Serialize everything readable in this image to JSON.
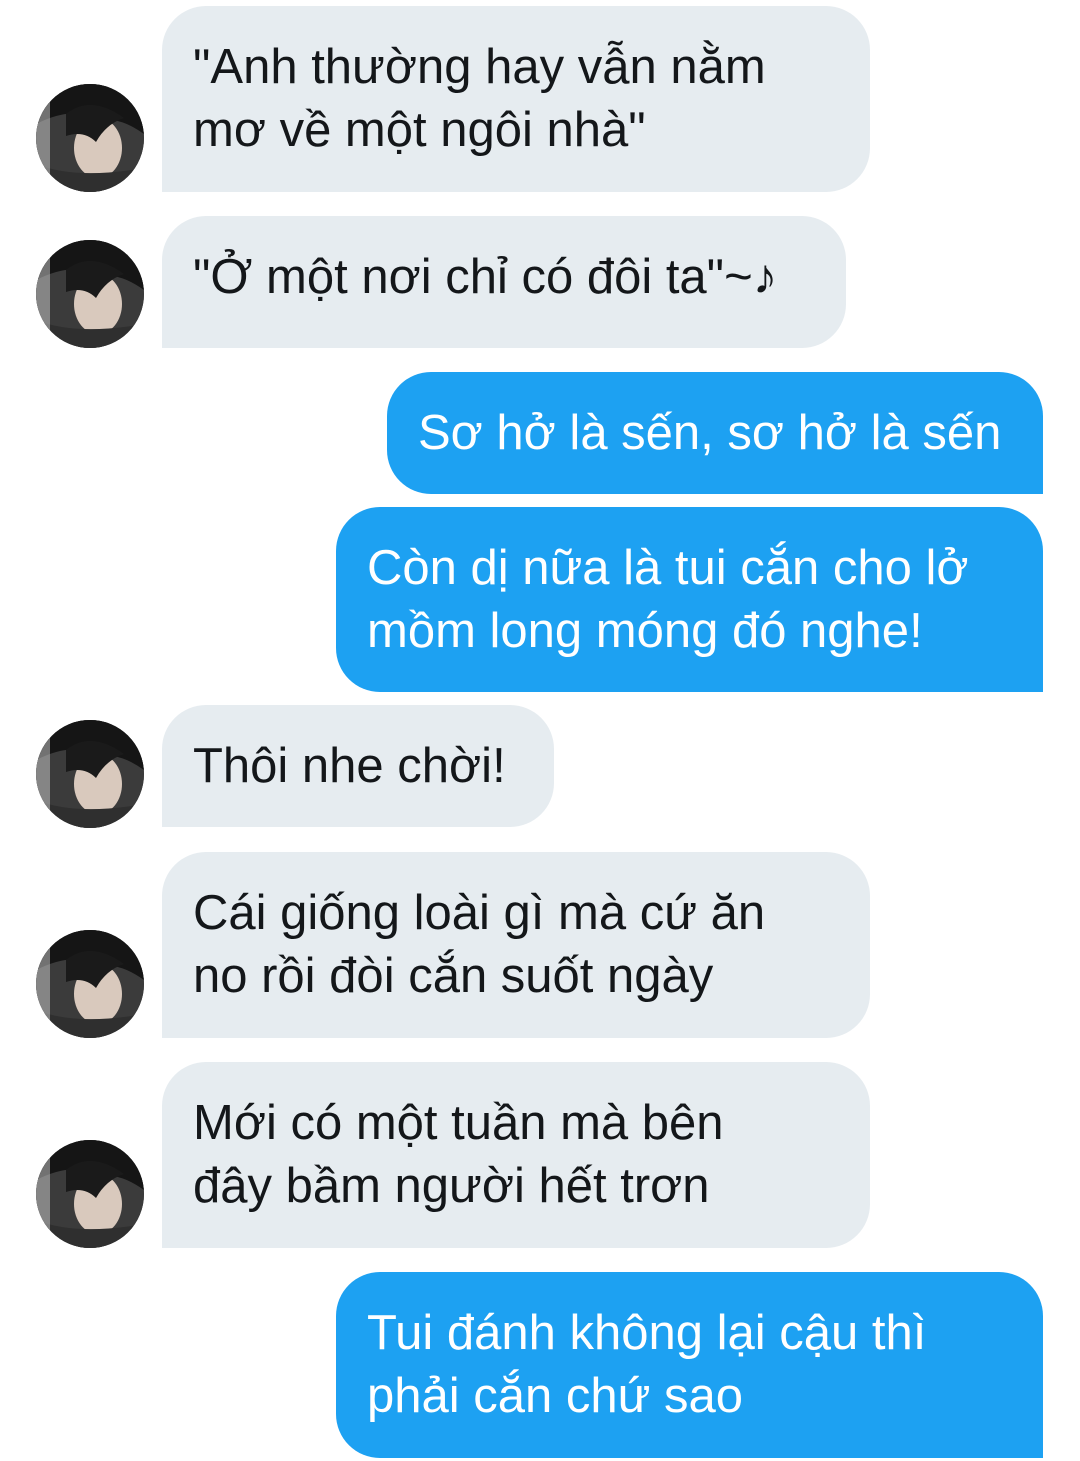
{
  "conversation": {
    "messages": [
      {
        "direction": "incoming",
        "text": "\"Anh thường hay vẫn nằm\nmơ về một ngôi nhà\"",
        "has_avatar": true
      },
      {
        "direction": "incoming",
        "text": "\"Ở một nơi chỉ có đôi ta\"~♪",
        "has_avatar": true
      },
      {
        "direction": "outgoing",
        "text": "Sơ hở là sến, sơ hở là sến"
      },
      {
        "direction": "outgoing",
        "text": "Còn dị nữa là tui cắn cho lở\nmồm long móng đó nghe!"
      },
      {
        "direction": "incoming",
        "text": "Thôi nhe chời!",
        "has_avatar": true
      },
      {
        "direction": "incoming",
        "text": "Cái giống loài gì mà cứ ăn\nno rồi đòi cắn suốt ngày",
        "has_avatar": true
      },
      {
        "direction": "incoming",
        "text": "Mới có một tuần mà bên\nđây bầm người hết trơn",
        "has_avatar": true
      },
      {
        "direction": "outgoing",
        "text": "Tui đánh không lại cậu thì\nphải cắn chứ sao"
      }
    ],
    "avatar_icon": "user-photo-avatar"
  },
  "colors": {
    "incoming_bubble": "#e6ecf0",
    "incoming_text": "#14171a",
    "outgoing_bubble": "#1da1f2",
    "outgoing_text": "#ffffff"
  }
}
